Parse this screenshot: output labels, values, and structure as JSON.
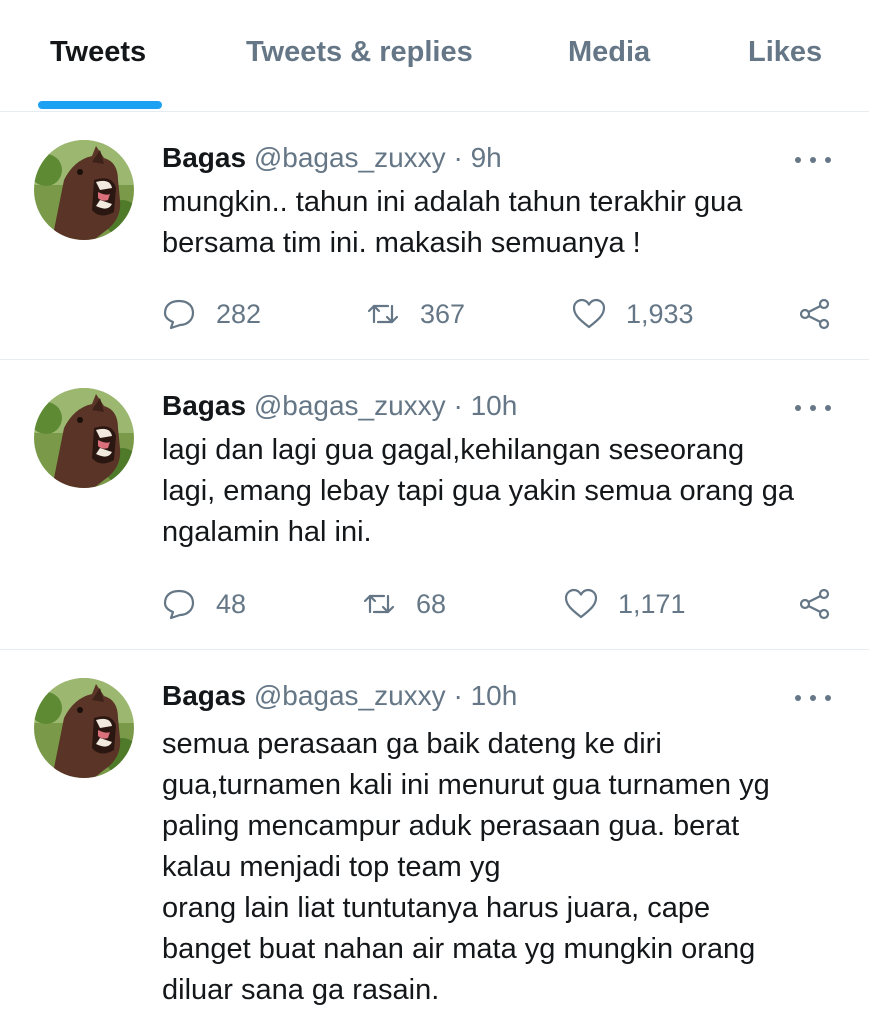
{
  "tabs": [
    {
      "label": "Tweets",
      "active": true
    },
    {
      "label": "Tweets & replies",
      "active": false
    },
    {
      "label": "Media",
      "active": false
    },
    {
      "label": "Likes",
      "active": false
    }
  ],
  "accent_color": "#1da1f2",
  "tweets": [
    {
      "display_name": "Bagas",
      "handle": "@bagas_zuxxy",
      "time": "9h",
      "text": "mungkin.. tahun ini adalah tahun terakhir gua\nbersama tim ini. makasih semuanya !",
      "replies": "282",
      "retweets": "367",
      "likes": "1,933"
    },
    {
      "display_name": "Bagas",
      "handle": "@bagas_zuxxy",
      "time": "10h",
      "text": "lagi dan lagi gua gagal,kehilangan seseorang\nlagi, emang lebay tapi gua yakin semua orang ga\nngalamin hal ini.",
      "replies": "48",
      "retweets": "68",
      "likes": "1,171"
    },
    {
      "display_name": "Bagas",
      "handle": "@bagas_zuxxy",
      "time": "10h",
      "text": "semua perasaan ga baik dateng ke diri\ngua,turnamen kali ini menurut gua turnamen yg\npaling mencampur aduk perasaan gua. berat\nkalau menjadi top team yg\norang lain liat tuntutanya harus juara, cape\nbanget buat nahan air mata yg mungkin orang\ndiluar sana ga rasain."
    }
  ],
  "icons": {
    "reply": "reply-icon",
    "retweet": "retweet-icon",
    "like": "heart-icon",
    "share": "share-icon",
    "more": "more-icon"
  }
}
